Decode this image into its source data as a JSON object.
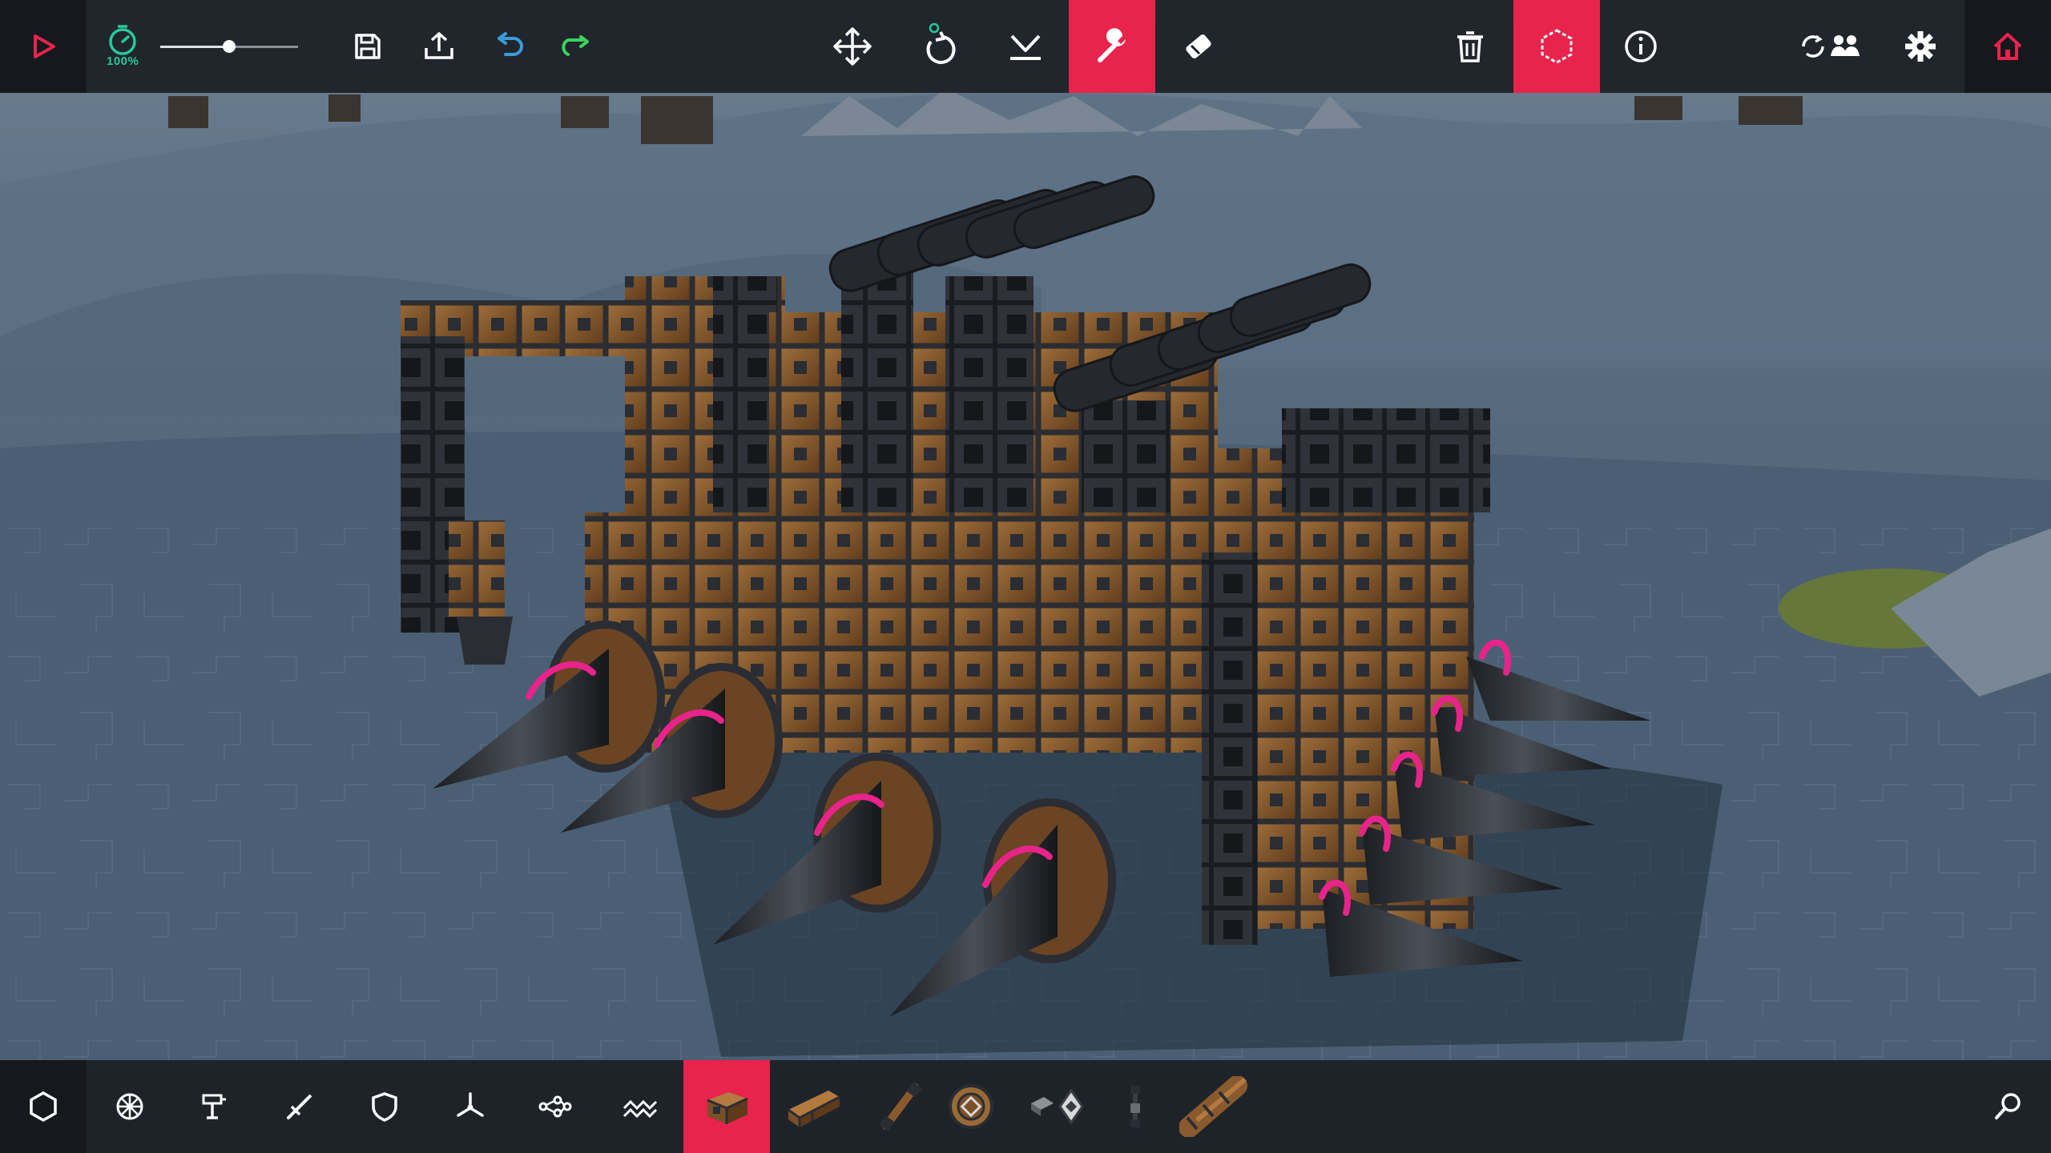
{
  "top_toolbar": {
    "play": {
      "icon": "play-icon"
    },
    "time_scale": {
      "icon": "stopwatch-icon",
      "label": "100%",
      "slider_value": 0.5
    },
    "save": {
      "icon": "save-icon"
    },
    "share": {
      "icon": "upload-icon"
    },
    "undo": {
      "icon": "undo-icon"
    },
    "redo": {
      "icon": "redo-icon"
    },
    "translate": {
      "icon": "move-arrows-icon"
    },
    "rotate": {
      "icon": "rotate-icon"
    },
    "drop": {
      "icon": "drop-to-ground-icon"
    },
    "tweak": {
      "icon": "wrench-icon",
      "active": true
    },
    "erase": {
      "icon": "eraser-icon"
    },
    "delete": {
      "icon": "trash-icon"
    },
    "symmetry": {
      "icon": "hexagon-dashed-icon",
      "active": true
    },
    "info": {
      "icon": "info-icon"
    },
    "multiplayer": {
      "icon": "sync-users-icon"
    },
    "settings": {
      "icon": "gear-icon"
    },
    "home": {
      "icon": "home-icon"
    }
  },
  "bottom_toolbar": {
    "categories": [
      {
        "name": "blocks",
        "icon": "hexagon-icon"
      },
      {
        "name": "locomotion",
        "icon": "wheel-icon"
      },
      {
        "name": "mechanical",
        "icon": "piston-icon"
      },
      {
        "name": "weaponry",
        "icon": "sword-icon"
      },
      {
        "name": "armour",
        "icon": "shield-icon"
      },
      {
        "name": "flight",
        "icon": "propeller-icon"
      },
      {
        "name": "automation",
        "icon": "nodes-icon"
      },
      {
        "name": "water",
        "icon": "waves-icon"
      }
    ],
    "blocks": [
      {
        "name": "wooden-block",
        "active": true
      },
      {
        "name": "small-wooden-block"
      },
      {
        "name": "wooden-pole"
      },
      {
        "name": "starting-block"
      },
      {
        "name": "metal-brace"
      },
      {
        "name": "metal-joint"
      },
      {
        "name": "log-block"
      }
    ],
    "search": {
      "icon": "search-icon"
    }
  },
  "colors": {
    "accent": "#e8234c",
    "toolbar_bg": "#1b1f25",
    "speed_label": "#27c99b",
    "redo_arrow": "#3bd45a",
    "undo_arrow": "#3b9bd9",
    "ground": "#55697f",
    "wood": "#7a4f2a",
    "iron": "#2a2d33",
    "rotation_marker": "#e8238a"
  }
}
